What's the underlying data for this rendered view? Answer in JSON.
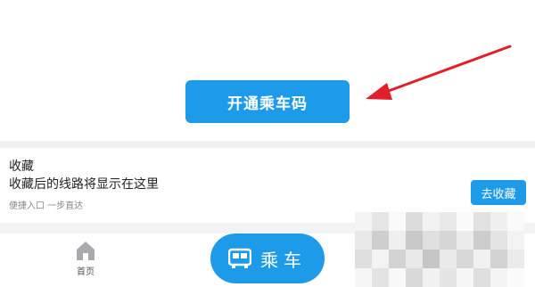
{
  "top": {
    "open_button_label": "开通乘车码"
  },
  "favorites": {
    "title": "收藏",
    "description": "收藏后的线路将显示在这里",
    "hint": "便捷入口 一步直达",
    "button_label": "去收藏"
  },
  "tabbar": {
    "home_label": "首页",
    "ride_label": "乘车"
  },
  "colors": {
    "accent": "#1e9be8",
    "arrow": "#e0202a"
  },
  "icons": {
    "home": "home-icon",
    "bus": "bus-icon",
    "arrow": "annotation-arrow"
  }
}
